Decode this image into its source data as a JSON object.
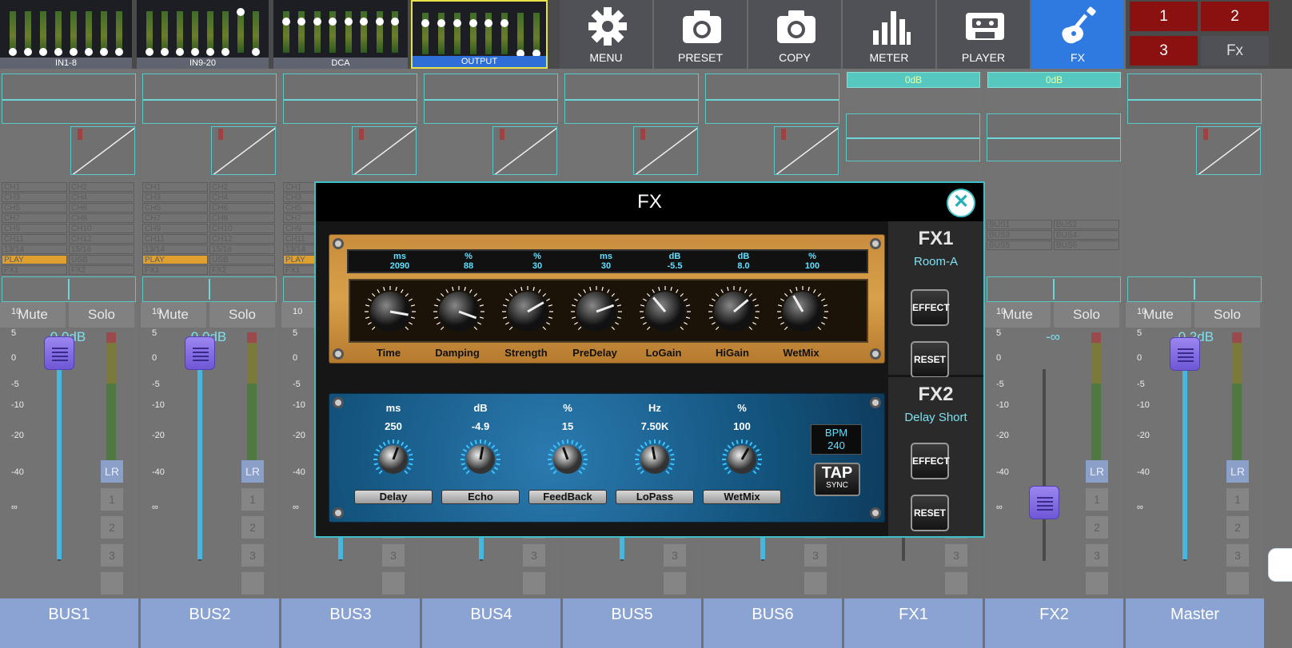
{
  "topbar": {
    "banks": [
      {
        "label": "IN1-8"
      },
      {
        "label": "IN9-20"
      },
      {
        "label": "DCA"
      },
      {
        "label": "OUTPUT",
        "selected": true
      }
    ],
    "nav": [
      {
        "label": "MENU",
        "icon": "gear-icon"
      },
      {
        "label": "PRESET",
        "icon": "camera-icon"
      },
      {
        "label": "COPY",
        "icon": "camera-icon"
      },
      {
        "label": "METER",
        "icon": "bar-chart-icon"
      },
      {
        "label": "PLAYER",
        "icon": "cassette-icon"
      },
      {
        "label": "FX",
        "icon": "guitar-icon",
        "active": true
      }
    ],
    "scenes": [
      {
        "label": "1"
      },
      {
        "label": "2"
      },
      {
        "label": "3"
      },
      {
        "label": "Fx"
      }
    ]
  },
  "strips": [
    {
      "name": "BUS1",
      "db": "0.0dB",
      "mute": "Mute",
      "solo": "Solo",
      "fader_level_db": 0
    },
    {
      "name": "BUS2",
      "db": "0.0dB",
      "mute": "Mute",
      "solo": "Solo",
      "fader_level_db": 0
    },
    {
      "name": "BUS3"
    },
    {
      "name": "BUS4"
    },
    {
      "name": "BUS5"
    },
    {
      "name": "BUS6"
    },
    {
      "name": "FX1",
      "odb": "0dB"
    },
    {
      "name": "FX2",
      "odb": "0dB",
      "db": "-∞",
      "mute": "Mute",
      "solo": "Solo"
    },
    {
      "name": "Master",
      "db": "-0.2dB",
      "mute": "Mute",
      "solo": "Solo",
      "fader_level_db": -0.2
    }
  ],
  "routing": {
    "left_col": [
      "CH1",
      "CH3",
      "CH5",
      "CH7",
      "CH9",
      "CH11",
      "13/14",
      "PLAY",
      "FX1"
    ],
    "right_col": [
      "CH2",
      "CH4",
      "CH6",
      "CH8",
      "CH10",
      "CH12",
      "15/16",
      "USB",
      "FX2"
    ],
    "fx2_left": [
      "BUS1",
      "BUS3",
      "BUS5"
    ],
    "fx2_right": [
      "BUS2",
      "BUS4",
      "BUS6"
    ]
  },
  "scale_labels": [
    "10",
    "5",
    "0",
    "-5",
    "-10",
    "-20",
    "-40",
    "∞"
  ],
  "send_buttons": [
    "LR",
    "1",
    "2",
    "3",
    ""
  ],
  "fx_modal": {
    "title": "FX",
    "fx1": {
      "name": "FX1",
      "type": "Room-A",
      "effect_label": "EFFECT",
      "reset_label": "RESET",
      "params": [
        {
          "unit": "ms",
          "value": "2090",
          "label": "Time"
        },
        {
          "unit": "%",
          "value": "88",
          "label": "Damping"
        },
        {
          "unit": "%",
          "value": "30",
          "label": "Strength"
        },
        {
          "unit": "ms",
          "value": "30",
          "label": "PreDelay"
        },
        {
          "unit": "dB",
          "value": "-5.5",
          "label": "LoGain"
        },
        {
          "unit": "dB",
          "value": "8.0",
          "label": "HiGain"
        },
        {
          "unit": "%",
          "value": "100",
          "label": "WetMix"
        }
      ]
    },
    "fx2": {
      "name": "FX2",
      "type": "Delay Short",
      "effect_label": "EFFECT",
      "reset_label": "RESET",
      "params": [
        {
          "unit": "ms",
          "value": "250",
          "label": "Delay"
        },
        {
          "unit": "dB",
          "value": "-4.9",
          "label": "Echo"
        },
        {
          "unit": "%",
          "value": "15",
          "label": "FeedBack"
        },
        {
          "unit": "Hz",
          "value": "7.50K",
          "label": "LoPass"
        },
        {
          "unit": "%",
          "value": "100",
          "label": "WetMix"
        }
      ],
      "bpm_label": "BPM",
      "bpm_value": "240",
      "tap_label": "TAP",
      "tap_sub": "SYNC"
    }
  },
  "colors": {
    "accent": "#2f7ae0",
    "teal": "#3bbfc9",
    "fader_knob": "#8a72ea",
    "strip_name_bg": "#8ba3d3",
    "scene_red": "#8b1010"
  }
}
